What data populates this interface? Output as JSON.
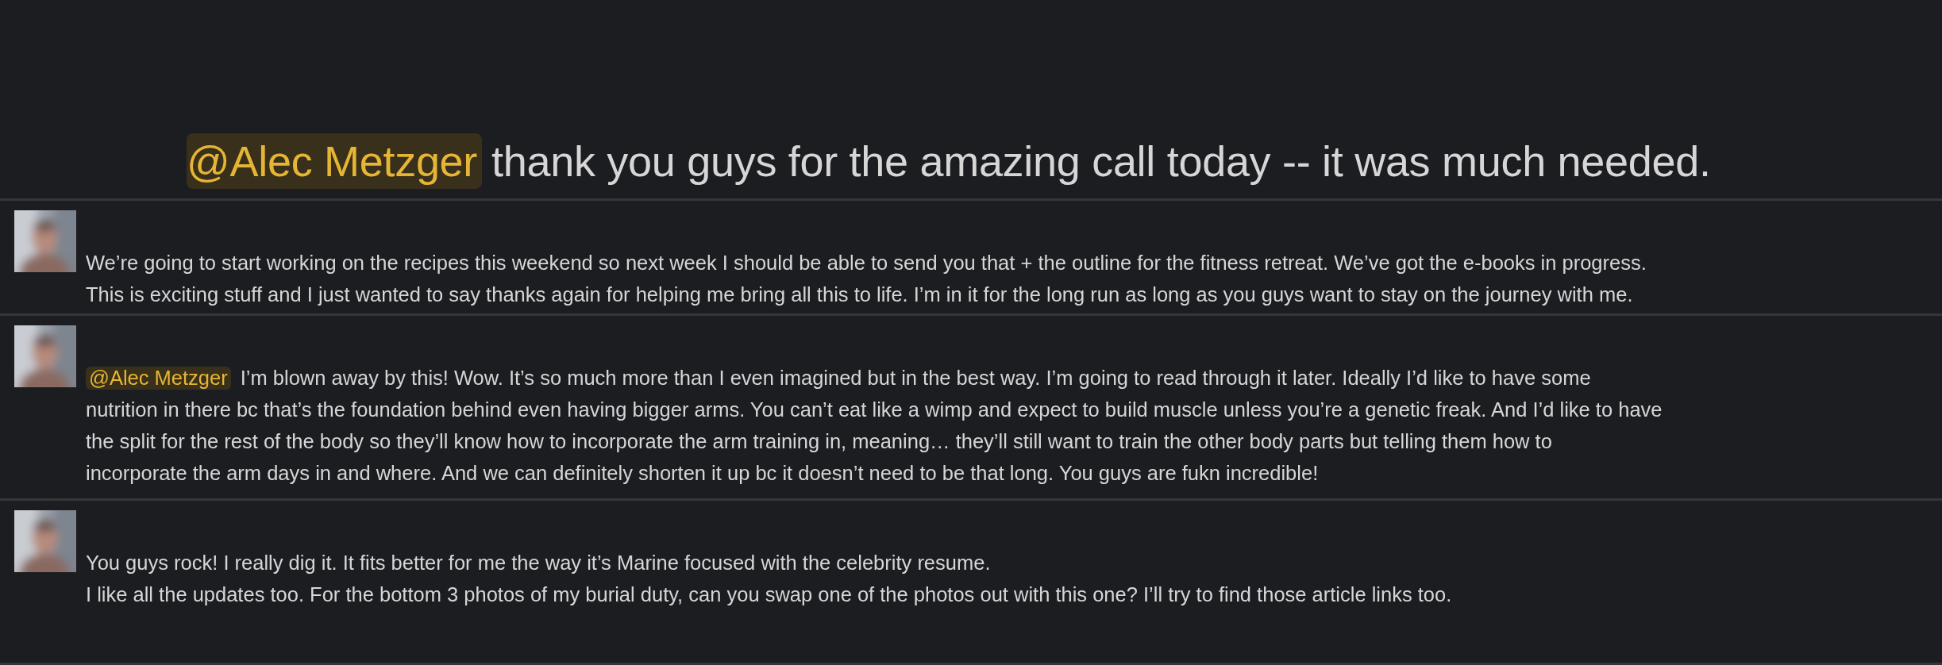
{
  "messages": [
    {
      "kind": "headline",
      "mention": "@Alec Metzger",
      "lines": [
        "thank you guys for the amazing call today -- it was much needed."
      ]
    },
    {
      "kind": "message",
      "lines": [
        "We’re going to start working on the recipes this weekend so next week I should be able to send you that + the outline for the fitness retreat. We’ve got the e-books in progress.",
        "This is exciting stuff and I just wanted to say thanks again for helping me bring all this to life. I’m in it for the long run as long as you guys want to stay on the journey with me."
      ]
    },
    {
      "kind": "message",
      "mention": "@Alec Metzger",
      "lines": [
        "I’m blown away by this! Wow. It’s so much more than I even imagined but in the best way. I’m going to read through it later. Ideally I’d like to have some",
        "nutrition in there bc that’s the foundation behind even having bigger arms. You can’t eat like a wimp and expect to build muscle unless you’re a genetic freak. And I’d like to have",
        "the split for the rest of the body so they’ll know how to incorporate the arm training in, meaning… they’ll still want to train the other body parts but telling them how to",
        "incorporate the arm days in and where. And we can definitely shorten it up bc it doesn’t need to be that long. You guys are fukn incredible!"
      ]
    },
    {
      "kind": "message",
      "lines": [
        "You guys rock! I really dig it. It fits better for me the way it’s Marine focused with the celebrity resume.",
        "I like all the updates too. For the bottom 3 photos of my burial duty, can you swap one of the photos out with this one? I’ll try to find those article links too."
      ]
    }
  ]
}
